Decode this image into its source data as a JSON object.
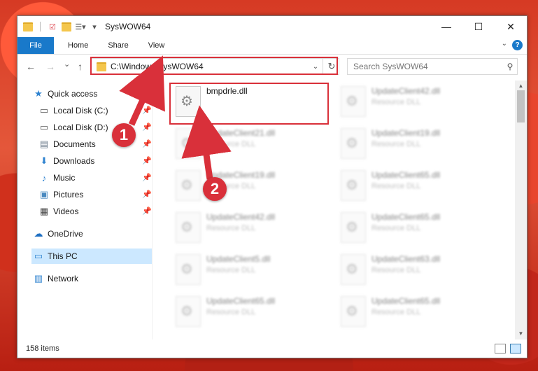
{
  "window": {
    "title": "SysWOW64",
    "controls": {
      "minimize": "—",
      "maximize": "☐",
      "close": "✕"
    }
  },
  "ribbon": {
    "file_tab": "File",
    "tabs": [
      "Home",
      "Share",
      "View"
    ],
    "help": "?"
  },
  "nav": {
    "back": "←",
    "forward": "→",
    "recent": "⌄",
    "up": "↑",
    "address": "C:\\Windows\\SysWOW64",
    "address_dropdown": "⌄",
    "refresh": "↻",
    "search_placeholder": "Search SysWOW64",
    "search_icon": "⚲"
  },
  "sidebar": {
    "quick_access": "Quick access",
    "pinned": [
      {
        "label": "Local Disk (C:)",
        "icon": "drive-icon"
      },
      {
        "label": "Local Disk (D:)",
        "icon": "drive-icon"
      },
      {
        "label": "Documents",
        "icon": "documents-icon"
      },
      {
        "label": "Downloads",
        "icon": "downloads-icon"
      },
      {
        "label": "Music",
        "icon": "music-icon"
      },
      {
        "label": "Pictures",
        "icon": "pictures-icon"
      },
      {
        "label": "Videos",
        "icon": "videos-icon"
      }
    ],
    "onedrive": "OneDrive",
    "this_pc": "This PC",
    "network": "Network"
  },
  "files": {
    "highlighted": {
      "name": "bmpdrle.dll"
    },
    "col1": [
      {
        "name": "UpdateClient21.dll",
        "type": "Resource DLL"
      },
      {
        "name": "UpdateClient19.dll",
        "type": "Resource DLL"
      },
      {
        "name": "UpdateClient42.dll",
        "type": "Resource DLL"
      },
      {
        "name": "UpdateClient5.dll",
        "type": "Resource DLL"
      },
      {
        "name": "UpdateClient65.dll",
        "type": "Resource DLL"
      }
    ],
    "col2": [
      {
        "name": "UpdateClient42.dll",
        "type": "Resource DLL"
      },
      {
        "name": "UpdateClient19.dll",
        "type": "Resource DLL"
      },
      {
        "name": "UpdateClient65.dll",
        "type": "Resource DLL"
      },
      {
        "name": "UpdateClient65.dll",
        "type": "Resource DLL"
      },
      {
        "name": "UpdateClient63.dll",
        "type": "Resource DLL"
      },
      {
        "name": "UpdateClient65.dll",
        "type": "Resource DLL"
      }
    ]
  },
  "status": {
    "item_count": "158 items"
  },
  "callouts": {
    "one": "1",
    "two": "2"
  },
  "colors": {
    "accent": "#1979ca",
    "highlight": "#d9303a"
  }
}
